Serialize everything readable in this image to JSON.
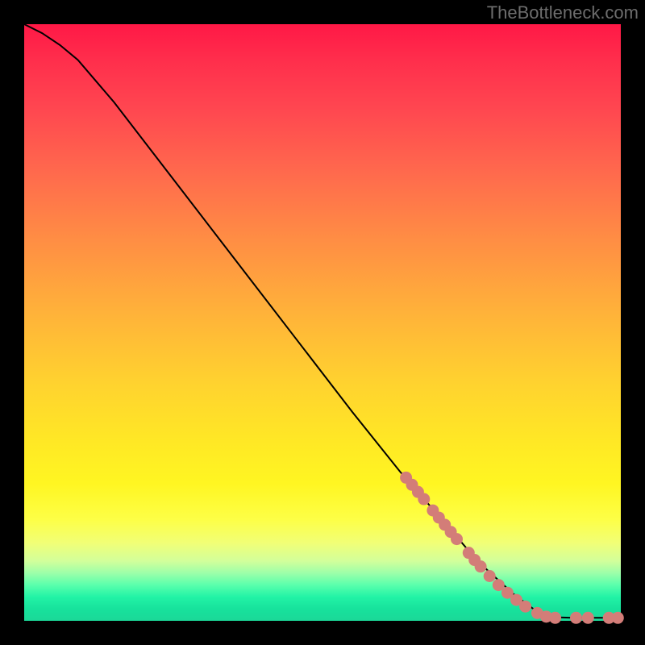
{
  "watermark": "TheBottleneck.com",
  "chart_data": {
    "type": "line",
    "title": "",
    "xlabel": "",
    "ylabel": "",
    "xlim": [
      0,
      100
    ],
    "ylim": [
      0,
      100
    ],
    "curve": [
      {
        "x": 0,
        "y": 100
      },
      {
        "x": 3,
        "y": 98.5
      },
      {
        "x": 6,
        "y": 96.5
      },
      {
        "x": 9,
        "y": 94
      },
      {
        "x": 15,
        "y": 87
      },
      {
        "x": 25,
        "y": 74
      },
      {
        "x": 35,
        "y": 61
      },
      {
        "x": 45,
        "y": 48
      },
      {
        "x": 55,
        "y": 35
      },
      {
        "x": 63,
        "y": 25
      },
      {
        "x": 70,
        "y": 17
      },
      {
        "x": 76,
        "y": 10
      },
      {
        "x": 82,
        "y": 4.5
      },
      {
        "x": 86,
        "y": 1.5
      },
      {
        "x": 88.5,
        "y": 0.6
      },
      {
        "x": 92,
        "y": 0.5
      },
      {
        "x": 97,
        "y": 0.5
      },
      {
        "x": 100,
        "y": 0.5
      }
    ],
    "markers": [
      {
        "x": 64,
        "y": 24
      },
      {
        "x": 65,
        "y": 22.8
      },
      {
        "x": 66,
        "y": 21.6
      },
      {
        "x": 67,
        "y": 20.4
      },
      {
        "x": 68.5,
        "y": 18.5
      },
      {
        "x": 69.5,
        "y": 17.3
      },
      {
        "x": 70.5,
        "y": 16.1
      },
      {
        "x": 71.5,
        "y": 14.9
      },
      {
        "x": 72.5,
        "y": 13.7
      },
      {
        "x": 74.5,
        "y": 11.4
      },
      {
        "x": 75.5,
        "y": 10.2
      },
      {
        "x": 76.5,
        "y": 9.1
      },
      {
        "x": 78,
        "y": 7.5
      },
      {
        "x": 79.5,
        "y": 6.0
      },
      {
        "x": 81,
        "y": 4.7
      },
      {
        "x": 82.5,
        "y": 3.5
      },
      {
        "x": 84,
        "y": 2.4
      },
      {
        "x": 86,
        "y": 1.3
      },
      {
        "x": 87.5,
        "y": 0.7
      },
      {
        "x": 89,
        "y": 0.5
      },
      {
        "x": 92.5,
        "y": 0.5
      },
      {
        "x": 94.5,
        "y": 0.5
      },
      {
        "x": 98,
        "y": 0.5
      },
      {
        "x": 99.5,
        "y": 0.5
      }
    ],
    "colors": {
      "curve": "#000000",
      "marker": "#d37d78"
    }
  }
}
